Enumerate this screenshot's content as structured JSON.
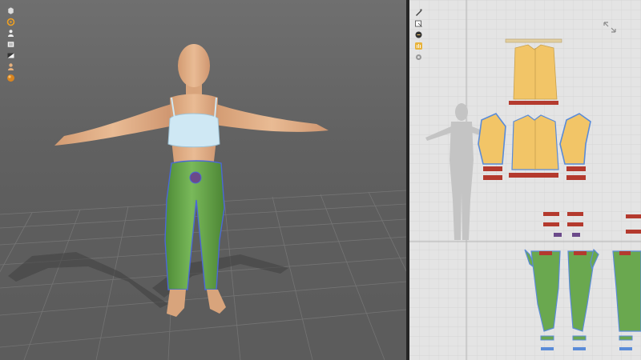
{
  "viewport_3d": {
    "toolbar": {
      "tools": [
        {
          "icon": "avatar-select-icon"
        },
        {
          "icon": "garment-pose-icon"
        },
        {
          "icon": "avatar-display-icon"
        },
        {
          "icon": "texture-display-icon"
        },
        {
          "icon": "fabric-render-icon"
        },
        {
          "icon": "skin-color-icon"
        },
        {
          "icon": "shading-ball-icon"
        }
      ]
    },
    "garments": {
      "top": {
        "name": "bra-top",
        "color": "#cfe8f4"
      },
      "bottom": {
        "name": "pants",
        "color": "#6aa84f"
      }
    },
    "avatar": {
      "skin_color": "#e4b089"
    }
  },
  "viewport_2d": {
    "toolbar": {
      "tools": [
        {
          "icon": "edit-pattern-icon"
        },
        {
          "icon": "transform-pattern-icon"
        },
        {
          "icon": "edit-sewing-icon"
        },
        {
          "icon": "hand-pan-icon"
        },
        {
          "icon": "pattern-settings-icon"
        }
      ]
    },
    "fullscreen_icon": "expand-arrows-icon",
    "pattern_colors": {
      "top": "#f2c567",
      "pants": "#6aa84f",
      "band": "#b43a2e",
      "seam": "#5a8bd8",
      "background": "#e4e4e4"
    }
  }
}
